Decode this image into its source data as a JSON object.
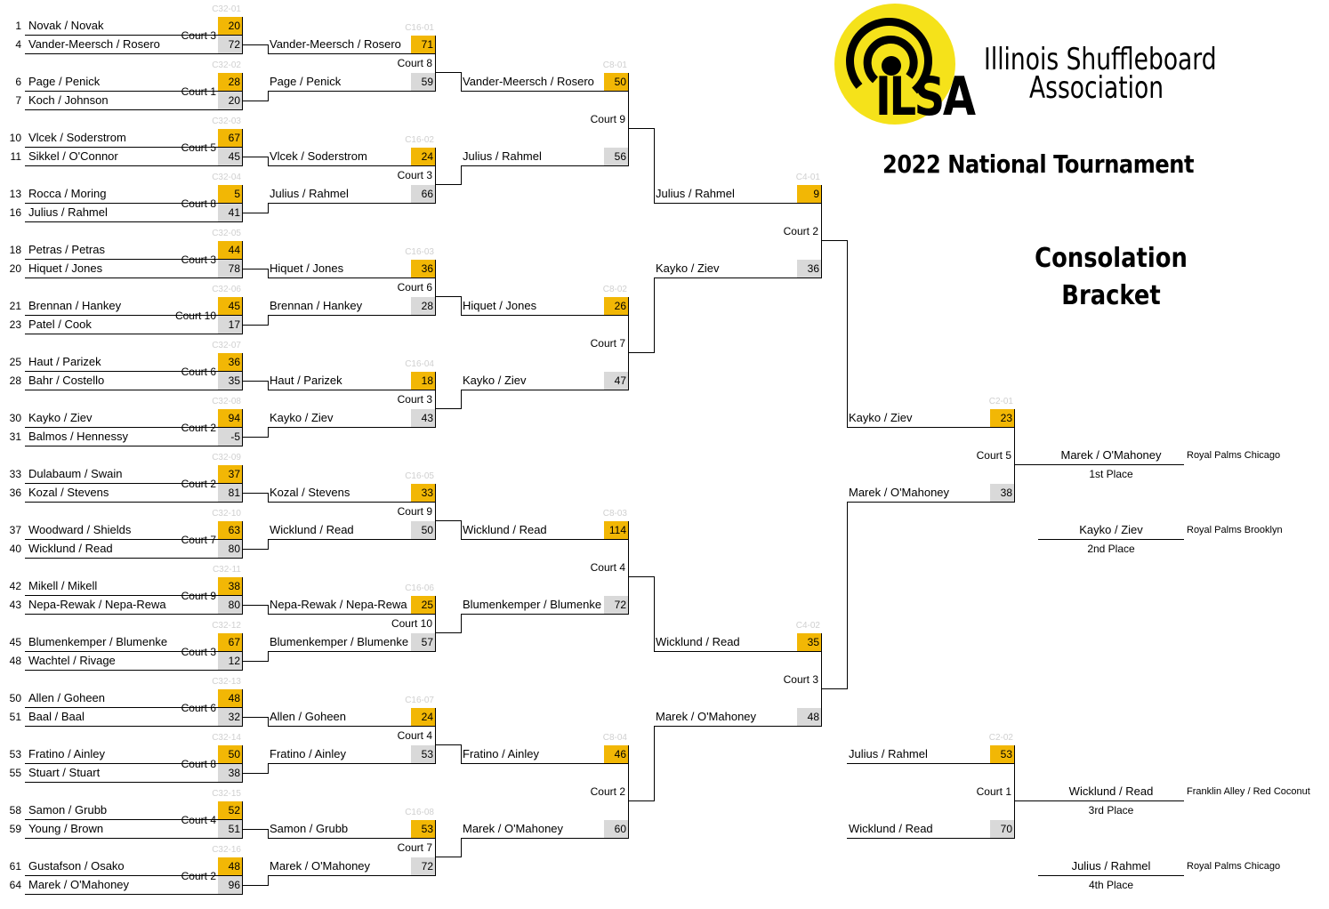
{
  "header": {
    "org_line1": "Illinois Shuffleboard",
    "org_line2": "Association",
    "logo_text": "ILSA",
    "tournament": "2022 National Tournament",
    "bracket_line1": "Consolation",
    "bracket_line2": "Bracket"
  },
  "r32": [
    {
      "id": "C32-01",
      "court": "Court 3",
      "t": [
        {
          "seed": "1",
          "name": "Novak / Novak",
          "score": "20"
        },
        {
          "seed": "4",
          "name": "Vander-Meersch / Rosero",
          "score": "72"
        }
      ]
    },
    {
      "id": "C32-02",
      "court": "Court 1",
      "t": [
        {
          "seed": "6",
          "name": "Page / Penick",
          "score": "28"
        },
        {
          "seed": "7",
          "name": "Koch / Johnson",
          "score": "20"
        }
      ]
    },
    {
      "id": "C32-03",
      "court": "Court 5",
      "t": [
        {
          "seed": "10",
          "name": "Vlcek / Soderstrom",
          "score": "67"
        },
        {
          "seed": "11",
          "name": "Sikkel / O'Connor",
          "score": "45"
        }
      ]
    },
    {
      "id": "C32-04",
      "court": "Court 8",
      "t": [
        {
          "seed": "13",
          "name": "Rocca / Moring",
          "score": "5"
        },
        {
          "seed": "16",
          "name": "Julius / Rahmel",
          "score": "41"
        }
      ]
    },
    {
      "id": "C32-05",
      "court": "Court 3",
      "t": [
        {
          "seed": "18",
          "name": "Petras / Petras",
          "score": "44"
        },
        {
          "seed": "20",
          "name": "Hiquet / Jones",
          "score": "78"
        }
      ]
    },
    {
      "id": "C32-06",
      "court": "Court 10",
      "t": [
        {
          "seed": "21",
          "name": "Brennan / Hankey",
          "score": "45"
        },
        {
          "seed": "23",
          "name": "Patel / Cook",
          "score": "17"
        }
      ]
    },
    {
      "id": "C32-07",
      "court": "Court 6",
      "t": [
        {
          "seed": "25",
          "name": "Haut / Parizek",
          "score": "36"
        },
        {
          "seed": "28",
          "name": "Bahr / Costello",
          "score": "35"
        }
      ]
    },
    {
      "id": "C32-08",
      "court": "Court 2",
      "t": [
        {
          "seed": "30",
          "name": "Kayko / Ziev",
          "score": "94"
        },
        {
          "seed": "31",
          "name": "Balmos / Hennessy",
          "score": "-5"
        }
      ]
    },
    {
      "id": "C32-09",
      "court": "Court 2",
      "t": [
        {
          "seed": "33",
          "name": "Dulabaum / Swain",
          "score": "37"
        },
        {
          "seed": "36",
          "name": "Kozal / Stevens",
          "score": "81"
        }
      ]
    },
    {
      "id": "C32-10",
      "court": "Court 7",
      "t": [
        {
          "seed": "37",
          "name": "Woodward / Shields",
          "score": "63"
        },
        {
          "seed": "40",
          "name": "Wicklund / Read",
          "score": "80"
        }
      ]
    },
    {
      "id": "C32-11",
      "court": "Court 9",
      "t": [
        {
          "seed": "42",
          "name": "Mikell / Mikell",
          "score": "38"
        },
        {
          "seed": "43",
          "name": "Nepa-Rewak / Nepa-Rewa",
          "score": "80"
        }
      ]
    },
    {
      "id": "C32-12",
      "court": "Court 3",
      "t": [
        {
          "seed": "45",
          "name": "Blumenkemper / Blumenke",
          "score": "67"
        },
        {
          "seed": "48",
          "name": "Wachtel / Rivage",
          "score": "12"
        }
      ]
    },
    {
      "id": "C32-13",
      "court": "Court 6",
      "t": [
        {
          "seed": "50",
          "name": "Allen / Goheen",
          "score": "48"
        },
        {
          "seed": "51",
          "name": "Baal / Baal",
          "score": "32"
        }
      ]
    },
    {
      "id": "C32-14",
      "court": "Court 8",
      "t": [
        {
          "seed": "53",
          "name": "Fratino / Ainley",
          "score": "50"
        },
        {
          "seed": "55",
          "name": "Stuart / Stuart",
          "score": "38"
        }
      ]
    },
    {
      "id": "C32-15",
      "court": "Court 4",
      "t": [
        {
          "seed": "58",
          "name": "Samon / Grubb",
          "score": "52"
        },
        {
          "seed": "59",
          "name": "Young / Brown",
          "score": "51"
        }
      ]
    },
    {
      "id": "C32-16",
      "court": "Court 2",
      "t": [
        {
          "seed": "61",
          "name": "Gustafson / Osako",
          "score": "48"
        },
        {
          "seed": "64",
          "name": "Marek / O'Mahoney",
          "score": "96"
        }
      ]
    }
  ],
  "r16": [
    {
      "id": "C16-01",
      "court": "Court 8",
      "t": [
        {
          "name": "Vander-Meersch / Rosero",
          "score": "71"
        },
        {
          "name": "Page / Penick",
          "score": "59"
        }
      ]
    },
    {
      "id": "C16-02",
      "court": "Court 3",
      "t": [
        {
          "name": "Vlcek / Soderstrom",
          "score": "24"
        },
        {
          "name": "Julius / Rahmel",
          "score": "66"
        }
      ]
    },
    {
      "id": "C16-03",
      "court": "Court 6",
      "t": [
        {
          "name": "Hiquet / Jones",
          "score": "36"
        },
        {
          "name": "Brennan / Hankey",
          "score": "28"
        }
      ]
    },
    {
      "id": "C16-04",
      "court": "Court 3",
      "t": [
        {
          "name": "Haut / Parizek",
          "score": "18"
        },
        {
          "name": "Kayko / Ziev",
          "score": "43"
        }
      ]
    },
    {
      "id": "C16-05",
      "court": "Court 9",
      "t": [
        {
          "name": "Kozal / Stevens",
          "score": "33"
        },
        {
          "name": "Wicklund / Read",
          "score": "50"
        }
      ]
    },
    {
      "id": "C16-06",
      "court": "Court 10",
      "t": [
        {
          "name": "Nepa-Rewak / Nepa-Rewa",
          "score": "25"
        },
        {
          "name": "Blumenkemper / Blumenke",
          "score": "57"
        }
      ]
    },
    {
      "id": "C16-07",
      "court": "Court 4",
      "t": [
        {
          "name": "Allen / Goheen",
          "score": "24"
        },
        {
          "name": "Fratino / Ainley",
          "score": "53"
        }
      ]
    },
    {
      "id": "C16-08",
      "court": "Court 7",
      "t": [
        {
          "name": "Samon / Grubb",
          "score": "53"
        },
        {
          "name": "Marek / O'Mahoney",
          "score": "72"
        }
      ]
    }
  ],
  "r8": [
    {
      "id": "C8-01",
      "court": "Court 9",
      "t": [
        {
          "name": "Vander-Meersch / Rosero",
          "score": "50"
        },
        {
          "name": "Julius / Rahmel",
          "score": "56"
        }
      ]
    },
    {
      "id": "C8-02",
      "court": "Court 7",
      "t": [
        {
          "name": "Hiquet / Jones",
          "score": "26"
        },
        {
          "name": "Kayko / Ziev",
          "score": "47"
        }
      ]
    },
    {
      "id": "C8-03",
      "court": "Court 4",
      "t": [
        {
          "name": "Wicklund / Read",
          "score": "114"
        },
        {
          "name": "Blumenkemper / Blumenke",
          "score": "72"
        }
      ]
    },
    {
      "id": "C8-04",
      "court": "Court 2",
      "t": [
        {
          "name": "Fratino / Ainley",
          "score": "46"
        },
        {
          "name": "Marek / O'Mahoney",
          "score": "60"
        }
      ]
    }
  ],
  "r4": [
    {
      "id": "C4-01",
      "court": "Court 2",
      "t": [
        {
          "name": "Julius / Rahmel",
          "score": "9"
        },
        {
          "name": "Kayko / Ziev",
          "score": "36"
        }
      ]
    },
    {
      "id": "C4-02",
      "court": "Court 3",
      "t": [
        {
          "name": "Wicklund / Read",
          "score": "35"
        },
        {
          "name": "Marek / O'Mahoney",
          "score": "48"
        }
      ]
    }
  ],
  "r2": [
    {
      "id": "C2-01",
      "court": "Court 5",
      "t": [
        {
          "name": "Kayko / Ziev",
          "score": "23"
        },
        {
          "name": "Marek / O'Mahoney",
          "score": "38"
        }
      ]
    },
    {
      "id": "C2-02",
      "court": "Court 1",
      "t": [
        {
          "name": "Julius / Rahmel",
          "score": "53"
        },
        {
          "name": "Wicklund / Read",
          "score": "70"
        }
      ]
    }
  ],
  "places": [
    {
      "name": "Marek / O'Mahoney",
      "label": "1st Place",
      "venue": "Royal Palms Chicago"
    },
    {
      "name": "Kayko / Ziev",
      "label": "2nd Place",
      "venue": "Royal Palms Brooklyn"
    },
    {
      "name": "Wicklund / Read",
      "label": "3rd Place",
      "venue": "Franklin Alley / Red Coconut"
    },
    {
      "name": "Julius / Rahmel",
      "label": "4th Place",
      "venue": "Royal Palms Chicago"
    }
  ],
  "colors": {
    "winner_score": "#f2b705",
    "loser_score": "#d9d9d9",
    "logo_yellow": "#f5e21a",
    "game_id": "#d0d0d0"
  }
}
